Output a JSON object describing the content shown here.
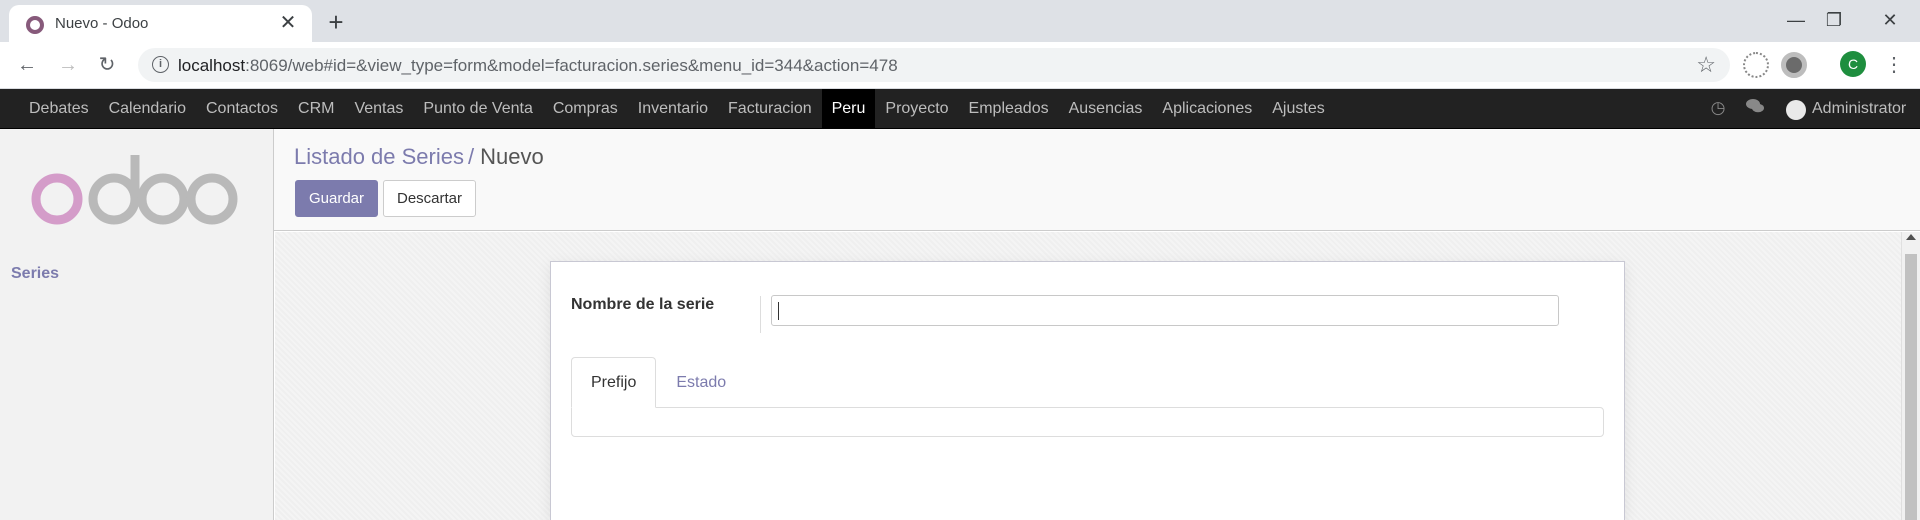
{
  "browser": {
    "tab_title": "Nuevo - Odoo",
    "tab_close": "✕",
    "new_tab": "+",
    "url_host": "localhost",
    "url_path": ":8069/web#id=&view_type=form&model=facturacion.series&menu_id=344&action=478",
    "profile_initial": "C",
    "window_controls": {
      "minimize": "—",
      "restore": "❐",
      "close": "✕"
    }
  },
  "navbar": {
    "menu": [
      "Debates",
      "Calendario",
      "Contactos",
      "CRM",
      "Ventas",
      "Punto de Venta",
      "Compras",
      "Inventario",
      "Facturacion",
      "Peru",
      "Proyecto",
      "Empleados",
      "Ausencias",
      "Aplicaciones",
      "Ajustes"
    ],
    "active": "Peru",
    "user": "Administrator"
  },
  "sidebar": {
    "logo_text": "odoo",
    "items": [
      "Series"
    ]
  },
  "control_panel": {
    "breadcrumb_parent": "Listado de Series",
    "breadcrumb_sep": "/",
    "breadcrumb_current": "Nuevo",
    "save_label": "Guardar",
    "discard_label": "Descartar"
  },
  "form": {
    "field_label": "Nombre de la serie",
    "field_value": "",
    "tabs": [
      "Prefijo",
      "Estado"
    ],
    "active_tab": "Prefijo"
  },
  "colors": {
    "primary": "#7c7bad",
    "odoo_purple": "#875a7b",
    "navbar_bg": "#222222",
    "logo_o_pink": "#d49cc9",
    "logo_gray": "#b9b9b9"
  }
}
